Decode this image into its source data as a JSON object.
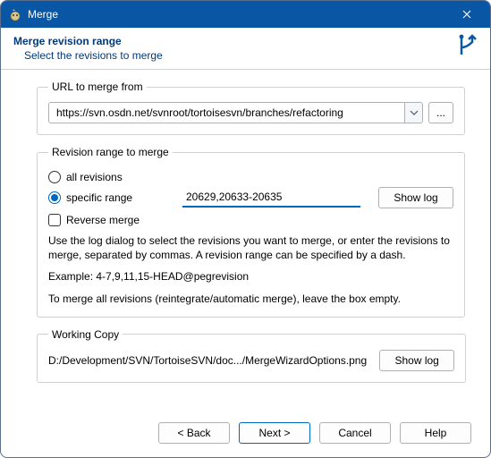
{
  "window": {
    "title": "Merge"
  },
  "header": {
    "title": "Merge revision range",
    "subtitle": "Select the revisions to merge"
  },
  "url_section": {
    "legend": "URL to merge from",
    "value": "https://svn.osdn.net/svnroot/tortoisesvn/branches/refactoring",
    "browse": "..."
  },
  "revision_section": {
    "legend": "Revision range to merge",
    "all_label": "all revisions",
    "specific_label": "specific range",
    "range_value": "20629,20633-20635",
    "show_log": "Show log",
    "reverse_label": "Reverse merge",
    "help1": "Use the log dialog to select the revisions you want to merge, or enter the revisions to merge, separated by commas. A revision range can be specified by a dash.",
    "example": "Example: 4-7,9,11,15-HEAD@pegrevision",
    "help2": "To merge all revisions (reintegrate/automatic merge), leave the box empty."
  },
  "wc_section": {
    "legend": "Working Copy",
    "path": "D:/Development/SVN/TortoiseSVN/doc.../MergeWizardOptions.png",
    "show_log": "Show log"
  },
  "buttons": {
    "back": "< Back",
    "next": "Next >",
    "cancel": "Cancel",
    "help": "Help"
  }
}
